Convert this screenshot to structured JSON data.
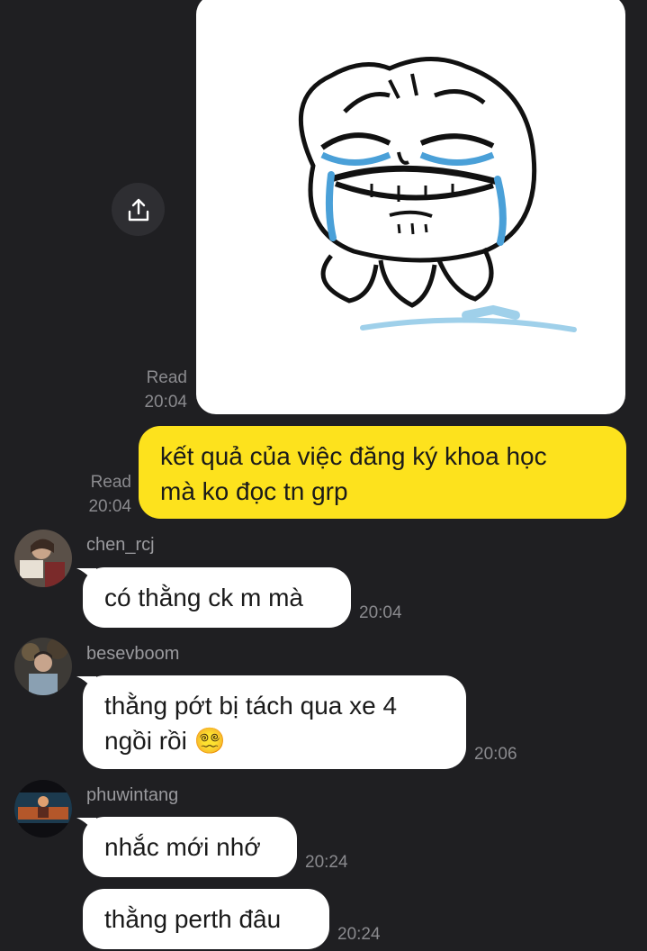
{
  "outgoing": {
    "sticker": {
      "read_label": "Read",
      "time": "20:04"
    },
    "text_message": {
      "text_line1": "kết quả của việc đăng ký khoa học",
      "text_line2": "mà ko đọc tn grp",
      "read_label": "Read",
      "time": "20:04"
    }
  },
  "incoming": [
    {
      "sender": "chen_rcj",
      "lines": [
        "có thằng ck m mà"
      ],
      "time": "20:04"
    },
    {
      "sender": "besevboom",
      "lines": [
        "thằng pớt bị tách qua xe 4",
        "ngồi rồi 😵‍💫"
      ],
      "time": "20:06"
    },
    {
      "sender": "phuwintang",
      "lines": [
        "nhắc mới nhớ"
      ],
      "time": "20:24"
    },
    {
      "sender": "",
      "lines": [
        "thằng perth đâu"
      ],
      "time": "20:24"
    }
  ],
  "icons": {
    "share": "share-upload-icon"
  },
  "colors": {
    "background": "#1f1f22",
    "outgoing_bubble": "#fde21d",
    "incoming_bubble": "#ffffff",
    "meta_text": "#8a8a8e"
  }
}
